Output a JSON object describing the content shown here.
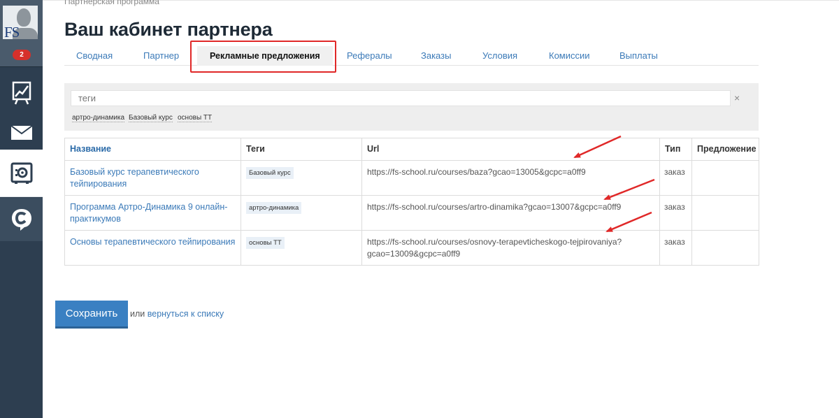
{
  "sidebar": {
    "avatar_logo": "FS",
    "notification_count": "2",
    "items": [
      {
        "icon": "chart-icon"
      },
      {
        "icon": "mail-icon"
      },
      {
        "icon": "safe-icon",
        "active": true
      },
      {
        "icon": "chat-c-icon"
      }
    ]
  },
  "breadcrumb": "Партнерская программа",
  "page_title": "Ваш кабинет партнера",
  "tabs": [
    {
      "label": "Сводная"
    },
    {
      "label": "Партнер"
    },
    {
      "label": "Рекламные предложения",
      "active": true
    },
    {
      "label": "Рефералы"
    },
    {
      "label": "Заказы"
    },
    {
      "label": "Условия"
    },
    {
      "label": "Комиссии"
    },
    {
      "label": "Выплаты"
    }
  ],
  "filter": {
    "placeholder": "теги",
    "clear": "×",
    "tags": [
      "артро-динамика",
      "Базовый курс",
      "основы ТТ"
    ]
  },
  "table": {
    "headers": {
      "name": "Название",
      "tags": "Теги",
      "url": "Url",
      "type": "Тип",
      "offer": "Предложение"
    },
    "rows": [
      {
        "name": "Базовый курс терапевтического тейпирования",
        "tag": "Базовый курс",
        "url": "https://fs-school.ru/courses/baza?gcao=13005&gcpc=a0ff9",
        "type": "заказ",
        "offer": ""
      },
      {
        "name": "Программа Артро-Динамика 9 онлайн-практикумов",
        "tag": "артро-динамика",
        "url": "https://fs-school.ru/courses/artro-dinamika?gcao=13007&gcpc=a0ff9",
        "type": "заказ",
        "offer": ""
      },
      {
        "name": "Основы терапевтического тейпирования",
        "tag": "основы ТТ",
        "url": "https://fs-school.ru/courses/osnovy-terapevticheskogo-tejpirovaniya?gcao=13009&gcpc=a0ff9",
        "type": "заказ",
        "offer": ""
      }
    ]
  },
  "actions": {
    "save_label": "Сохранить",
    "or_text": "или",
    "back_label": "вернуться к списку"
  },
  "colors": {
    "sidebar": "#2d3e50",
    "accent": "#3a80c2",
    "link": "#3b7ab8",
    "annotation": "#e02828",
    "badge": "#d6302b"
  }
}
